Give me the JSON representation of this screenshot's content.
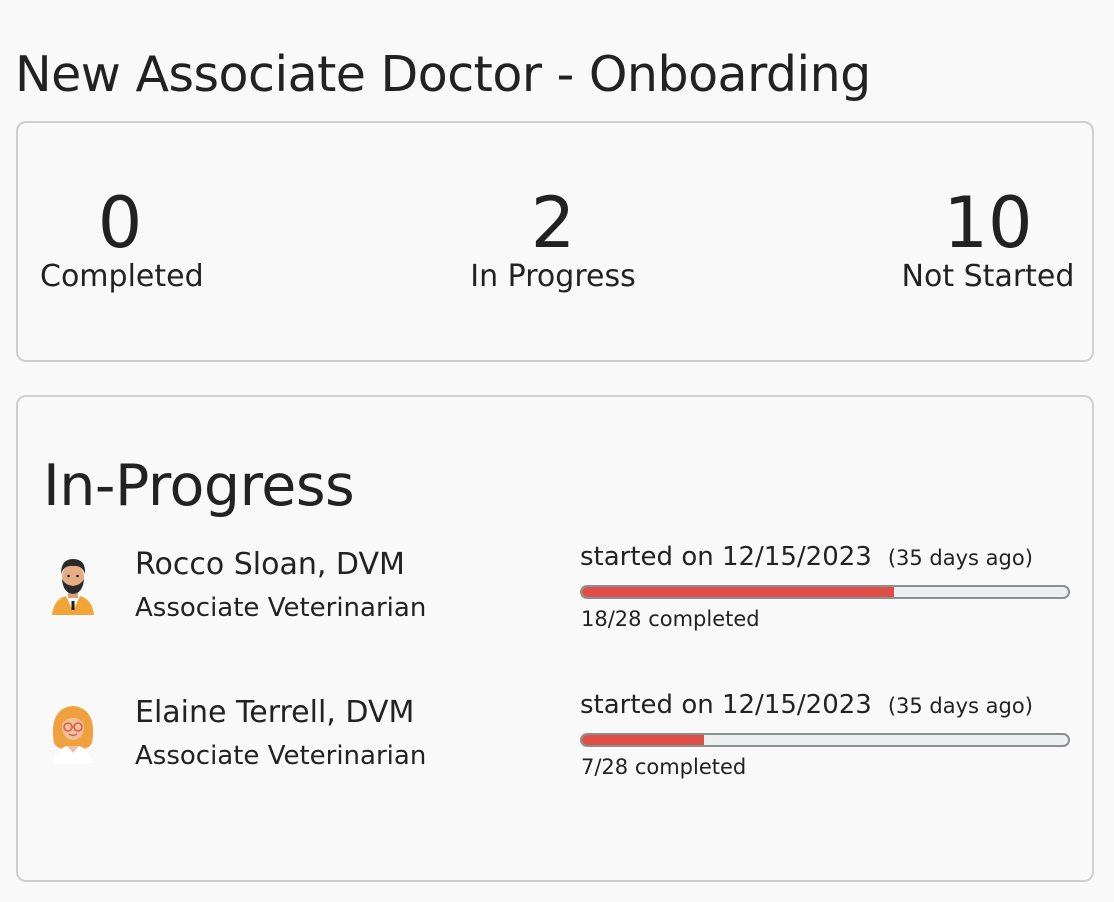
{
  "page": {
    "title": "New Associate Doctor - Onboarding"
  },
  "summary": {
    "completed": {
      "value": "0",
      "label": "Completed"
    },
    "in_progress": {
      "value": "2",
      "label": "In Progress"
    },
    "not_started": {
      "value": "10",
      "label": "Not Started"
    }
  },
  "in_progress_section": {
    "title": "In-Progress",
    "people": [
      {
        "name": "Rocco Sloan, DVM",
        "role": "Associate Veterinarian",
        "started": "started on 12/15/2023",
        "days_ago": "(35 days ago)",
        "completed_text": "18/28 completed",
        "progress_fraction": 0.643,
        "avatar_icon": "male-doctor-avatar"
      },
      {
        "name": "Elaine Terrell, DVM",
        "role": "Associate Veterinarian",
        "started": "started on 12/15/2023",
        "days_ago": "(35 days ago)",
        "completed_text": "7/28 completed",
        "progress_fraction": 0.25,
        "avatar_icon": "female-doctor-avatar"
      }
    ]
  },
  "colors": {
    "progress_fill": "#df4f47",
    "progress_track": "#ecefef",
    "card_border": "#cfcfcf"
  }
}
